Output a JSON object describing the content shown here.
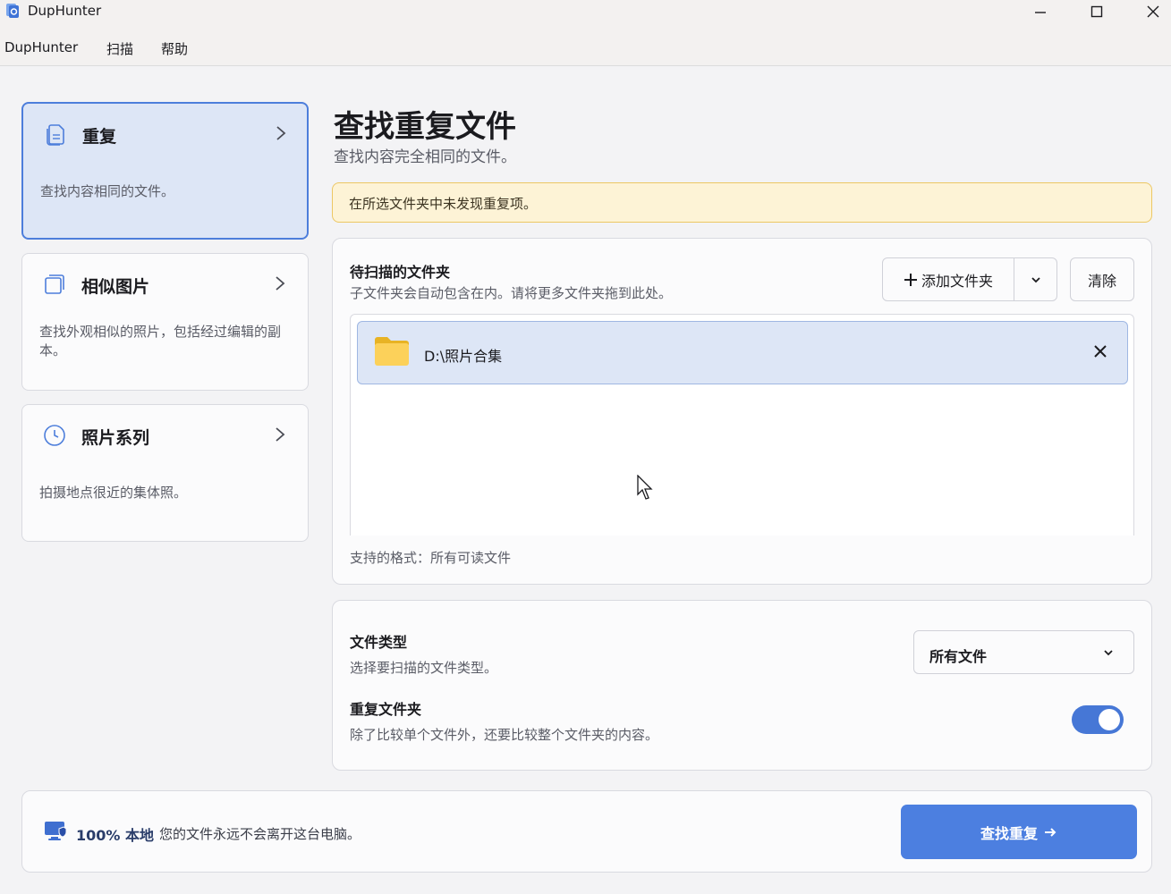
{
  "window": {
    "title": "DupHunter"
  },
  "menu": {
    "items": [
      "DupHunter",
      "扫描",
      "帮助"
    ]
  },
  "sidebar": {
    "items": [
      {
        "label": "重复",
        "desc": "查找内容相同的文件。",
        "icon": "document-duplicate-icon",
        "active": true
      },
      {
        "label": "相似图片",
        "desc": "查找外观相似的照片，包括经过编辑的副本。",
        "icon": "photo-stack-icon",
        "active": false
      },
      {
        "label": "照片系列",
        "desc": "拍摄地点很近的集体照。",
        "icon": "clock-icon",
        "active": false
      }
    ]
  },
  "main": {
    "title": "查找重复文件",
    "subtitle": "查找内容完全相同的文件。",
    "warning": "在所选文件夹中未发现重复项。"
  },
  "folders_panel": {
    "label": "待扫描的文件夹",
    "hint": "子文件夹会自动包含在内。请将更多文件夹拖到此处。",
    "add_button": "添加文件夹",
    "clear_button": "清除",
    "folders": [
      {
        "path": "D:\\照片合集"
      }
    ],
    "formats": "支持的格式：所有可读文件"
  },
  "options_panel": {
    "file_type_label": "文件类型",
    "file_type_hint": "选择要扫描的文件类型。",
    "file_type_value": "所有文件",
    "dup_folder_label": "重复文件夹",
    "dup_folder_hint": "除了比较单个文件外，还要比较整个文件夹的内容。",
    "dup_folder_enabled": true
  },
  "footer": {
    "badge": "100% 本地",
    "note": "您的文件永远不会离开这台电脑。",
    "find_button": "查找重复"
  },
  "colors": {
    "accent": "#4c7fe0",
    "active_card_bg": "#dde6f6",
    "warning_bg": "#fdf3d6",
    "warning_border": "#ecc763"
  }
}
